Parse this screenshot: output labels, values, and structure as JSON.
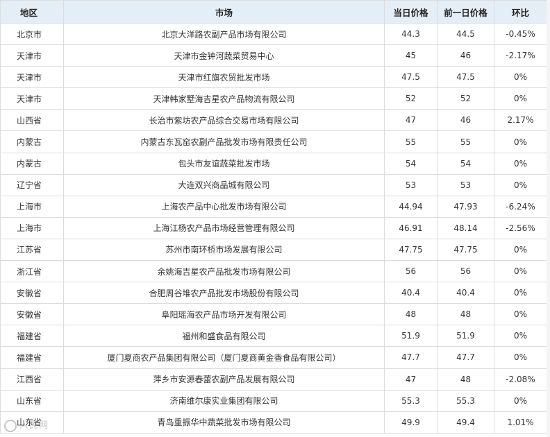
{
  "headers": {
    "region": "地区",
    "market": "市场",
    "today_price": "当日价格",
    "prev_price": "前一日价格",
    "ratio": "环比"
  },
  "rows": [
    {
      "region": "北京市",
      "market": "北京大洋路农副产品市场有限公司",
      "today": "44.3",
      "prev": "44.5",
      "ratio": "-0.45%"
    },
    {
      "region": "天津市",
      "market": "天津市金钟河蔬菜贸易中心",
      "today": "45",
      "prev": "46",
      "ratio": "-2.17%"
    },
    {
      "region": "天津市",
      "market": "天津市红旗农贸批发市场",
      "today": "47.5",
      "prev": "47.5",
      "ratio": "0%"
    },
    {
      "region": "天津市",
      "market": "天津韩家墅海吉星农产品物流有限公司",
      "today": "52",
      "prev": "52",
      "ratio": "0%"
    },
    {
      "region": "山西省",
      "market": "长治市紫坊农产品综合交易市场有限公司",
      "today": "47",
      "prev": "46",
      "ratio": "2.17%"
    },
    {
      "region": "内蒙古",
      "market": "内蒙古东瓦窑农副产品批发市场有限责任公司",
      "today": "55",
      "prev": "55",
      "ratio": "0%"
    },
    {
      "region": "内蒙古",
      "market": "包头市友谊蔬菜批发市场",
      "today": "54",
      "prev": "54",
      "ratio": "0%"
    },
    {
      "region": "辽宁省",
      "market": "大连双兴商品城有限公司",
      "today": "53",
      "prev": "53",
      "ratio": "0%"
    },
    {
      "region": "上海市",
      "market": "上海农产品中心批发市场有限公司",
      "today": "44.94",
      "prev": "47.93",
      "ratio": "-6.24%"
    },
    {
      "region": "上海市",
      "market": "上海江杨农产品市场经营管理有限公司",
      "today": "46.91",
      "prev": "48.14",
      "ratio": "-2.56%"
    },
    {
      "region": "江苏省",
      "market": "苏州市南环桥市场发展有限公司",
      "today": "47.75",
      "prev": "47.75",
      "ratio": "0%"
    },
    {
      "region": "浙江省",
      "market": "余姚海吉星农产品批发市场有限公司",
      "today": "56",
      "prev": "56",
      "ratio": "0%"
    },
    {
      "region": "安徽省",
      "market": "合肥周谷堆农产品批发市场股份有限公司",
      "today": "40.4",
      "prev": "40.4",
      "ratio": "0%"
    },
    {
      "region": "安徽省",
      "market": "阜阳瑶海农产品市场开发有限公司",
      "today": "48",
      "prev": "48",
      "ratio": "0%"
    },
    {
      "region": "福建省",
      "market": "福州和盛食品有限公司",
      "today": "51.9",
      "prev": "51.9",
      "ratio": "0%"
    },
    {
      "region": "福建省",
      "market": "厦门夏商农产品集团有限公司（厦门夏商黄金香食品有限公司）",
      "today": "47.7",
      "prev": "47.7",
      "ratio": "0%"
    },
    {
      "region": "江西省",
      "market": "萍乡市安源春蕾农副产品发展有限公司",
      "today": "47",
      "prev": "48",
      "ratio": "-2.08%"
    },
    {
      "region": "山东省",
      "market": "济南维尔康实业集团有限公司",
      "today": "55.3",
      "prev": "55.3",
      "ratio": "0%"
    },
    {
      "region": "山东省",
      "market": "青岛重振华中蔬菜批发市场有限公司",
      "today": "49.9",
      "prev": "49.4",
      "ratio": "1.01%"
    }
  ],
  "watermark": "人民网"
}
